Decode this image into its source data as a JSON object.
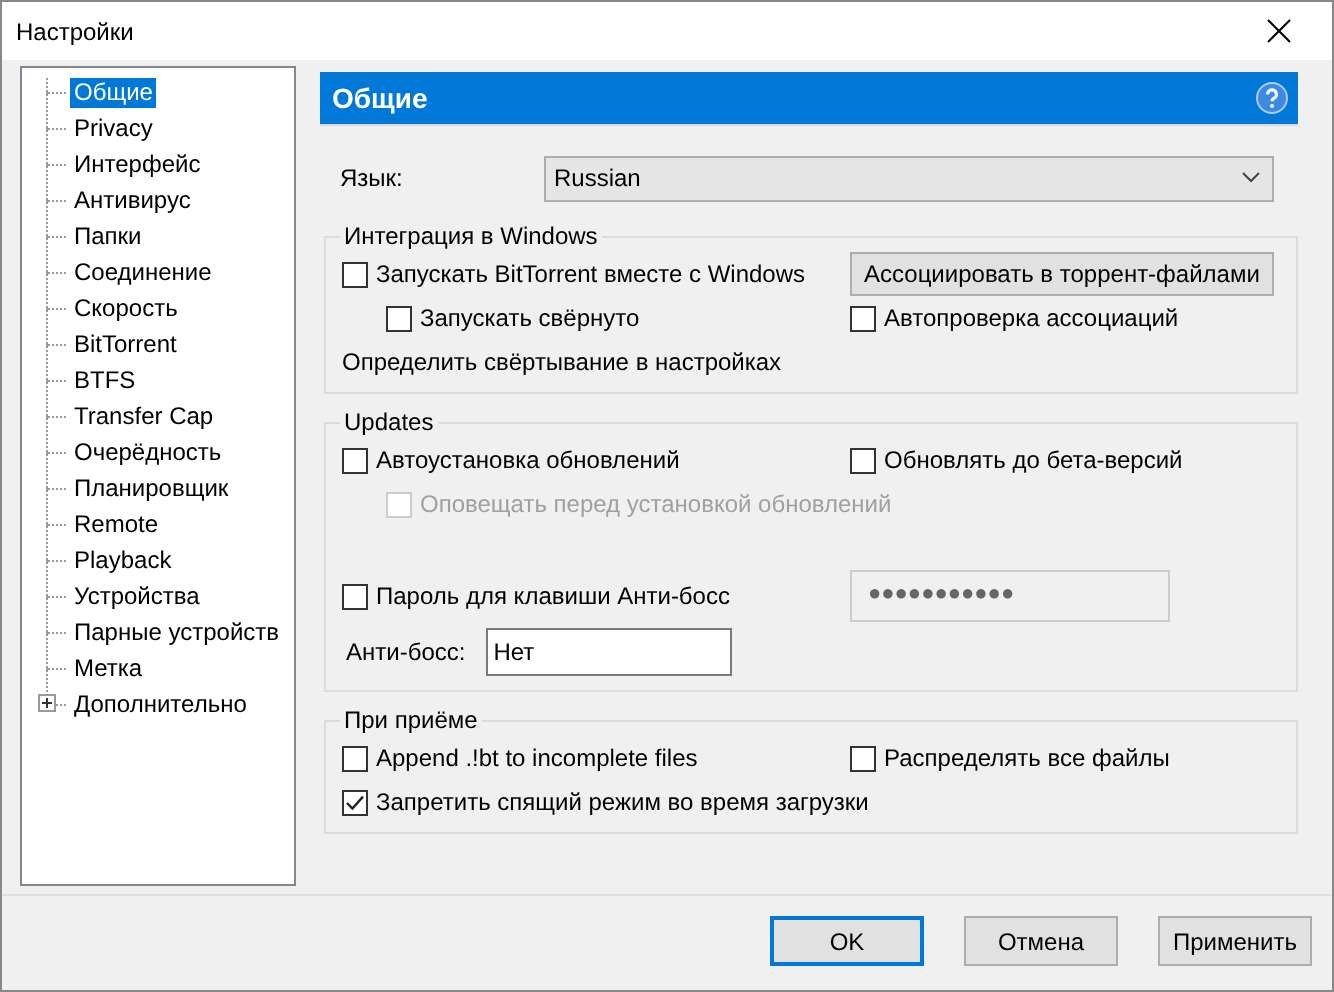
{
  "window": {
    "title": "Настройки"
  },
  "tree": {
    "items": [
      {
        "label": "Общие",
        "selected": true
      },
      {
        "label": "Privacy",
        "selected": false
      },
      {
        "label": "Интерфейс",
        "selected": false
      },
      {
        "label": "Антивирус",
        "selected": false
      },
      {
        "label": "Папки",
        "selected": false
      },
      {
        "label": "Соединение",
        "selected": false
      },
      {
        "label": "Скорость",
        "selected": false
      },
      {
        "label": "BitTorrent",
        "selected": false
      },
      {
        "label": "BTFS",
        "selected": false
      },
      {
        "label": "Transfer Cap",
        "selected": false
      },
      {
        "label": "Очерёдность",
        "selected": false
      },
      {
        "label": "Планировщик",
        "selected": false
      },
      {
        "label": "Remote",
        "selected": false
      },
      {
        "label": "Playback",
        "selected": false
      },
      {
        "label": "Устройства",
        "selected": false
      },
      {
        "label": "Парные устройств",
        "selected": false
      },
      {
        "label": "Метка",
        "selected": false
      },
      {
        "label": "Дополнительно",
        "selected": false,
        "expanded": false
      }
    ]
  },
  "panel": {
    "title": "Общие",
    "language": {
      "label": "Язык:",
      "value": "Russian"
    },
    "groups": [
      {
        "title": "Интеграция в Windows",
        "rows": [
          [
            {
              "kind": "checkbox",
              "label": "Запускать BitTorrent вместе с Windows",
              "checked": false,
              "disabled": false
            },
            {
              "kind": "button",
              "label": "Ассоциировать в торрент-файлами"
            }
          ],
          [
            {
              "kind": "subcheckbox",
              "label": "Запускать свёрнуто",
              "checked": false,
              "disabled": false
            },
            {
              "kind": "checkbox",
              "label": "Автопроверка ассоциаций",
              "checked": false,
              "disabled": false
            }
          ],
          [
            {
              "kind": "text",
              "label": "Определить свёртывание в настройках"
            }
          ]
        ]
      },
      {
        "title": "Updates",
        "rows": [
          [
            {
              "kind": "checkbox",
              "label": "Автоустановка обновлений",
              "checked": false,
              "disabled": false
            },
            {
              "kind": "checkbox",
              "label": "Обновлять до бета-версий",
              "checked": false,
              "disabled": false
            }
          ],
          [
            {
              "kind": "subcheckbox",
              "label": "Оповещать перед установкой обновлений",
              "checked": false,
              "disabled": true
            }
          ],
          [
            {
              "kind": "gap"
            }
          ],
          [
            {
              "kind": "checkbox",
              "label": "Пароль для клавиши Анти-босс",
              "checked": false,
              "disabled": false
            },
            {
              "kind": "password",
              "value": "●●●●●●●●●●●"
            }
          ],
          [
            {
              "kind": "field",
              "label": "Анти-босс:",
              "value": "Нет"
            }
          ]
        ]
      },
      {
        "title": "При приёме",
        "rows": [
          [
            {
              "kind": "checkbox",
              "label": "Append .!bt to incomplete files",
              "checked": false,
              "disabled": false
            },
            {
              "kind": "checkbox",
              "label": "Распределять все файлы",
              "checked": false,
              "disabled": false
            }
          ],
          [
            {
              "kind": "checkbox",
              "label": "Запретить спящий режим во время загрузки",
              "checked": true,
              "disabled": false
            }
          ]
        ]
      }
    ]
  },
  "buttons": [
    {
      "label": "OK",
      "default": true
    },
    {
      "label": "Отмена",
      "default": false
    },
    {
      "label": "Применить",
      "default": false
    }
  ]
}
